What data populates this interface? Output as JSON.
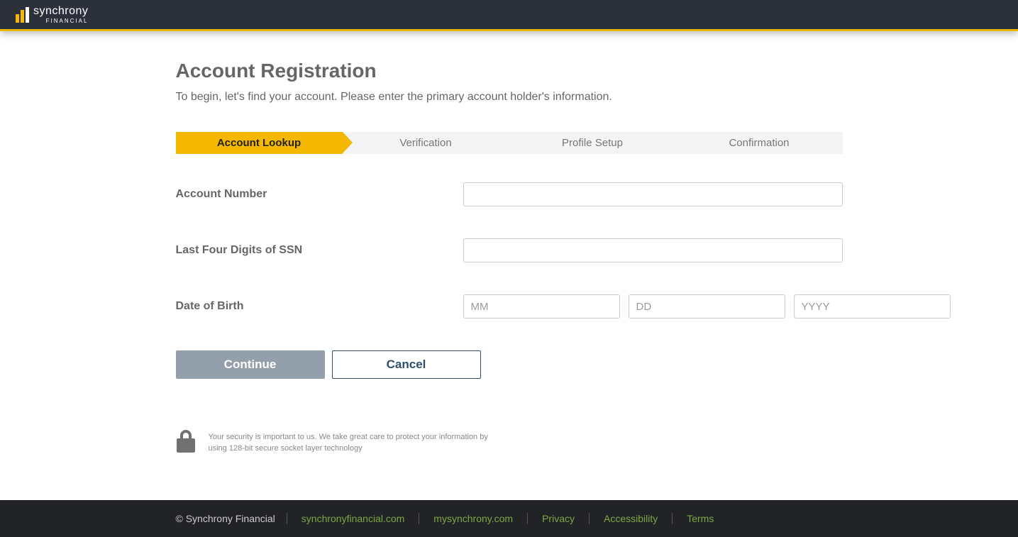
{
  "header": {
    "brand": "synchrony",
    "brand_sub": "FINANCIAL"
  },
  "page": {
    "title": "Account Registration",
    "subtitle": "To begin, let's find your account. Please enter the primary account holder's information."
  },
  "steps": [
    {
      "label": "Account Lookup",
      "active": true
    },
    {
      "label": "Verification",
      "active": false
    },
    {
      "label": "Profile Setup",
      "active": false
    },
    {
      "label": "Confirmation",
      "active": false
    }
  ],
  "form": {
    "account_number": {
      "label": "Account Number",
      "value": ""
    },
    "ssn_last4": {
      "label": "Last Four Digits of SSN",
      "value": ""
    },
    "dob": {
      "label": "Date of Birth",
      "mm": {
        "placeholder": "MM",
        "value": ""
      },
      "dd": {
        "placeholder": "DD",
        "value": ""
      },
      "yyyy": {
        "placeholder": "YYYY",
        "value": ""
      }
    }
  },
  "buttons": {
    "continue": "Continue",
    "cancel": "Cancel"
  },
  "security": {
    "text": "Your security is important to us. We take great care to protect your information by using 128-bit secure socket layer technology"
  },
  "footer": {
    "copyright": "© Synchrony Financial",
    "links": [
      "synchronyfinancial.com",
      "mysynchrony.com",
      "Privacy",
      "Accessibility",
      "Terms"
    ]
  }
}
